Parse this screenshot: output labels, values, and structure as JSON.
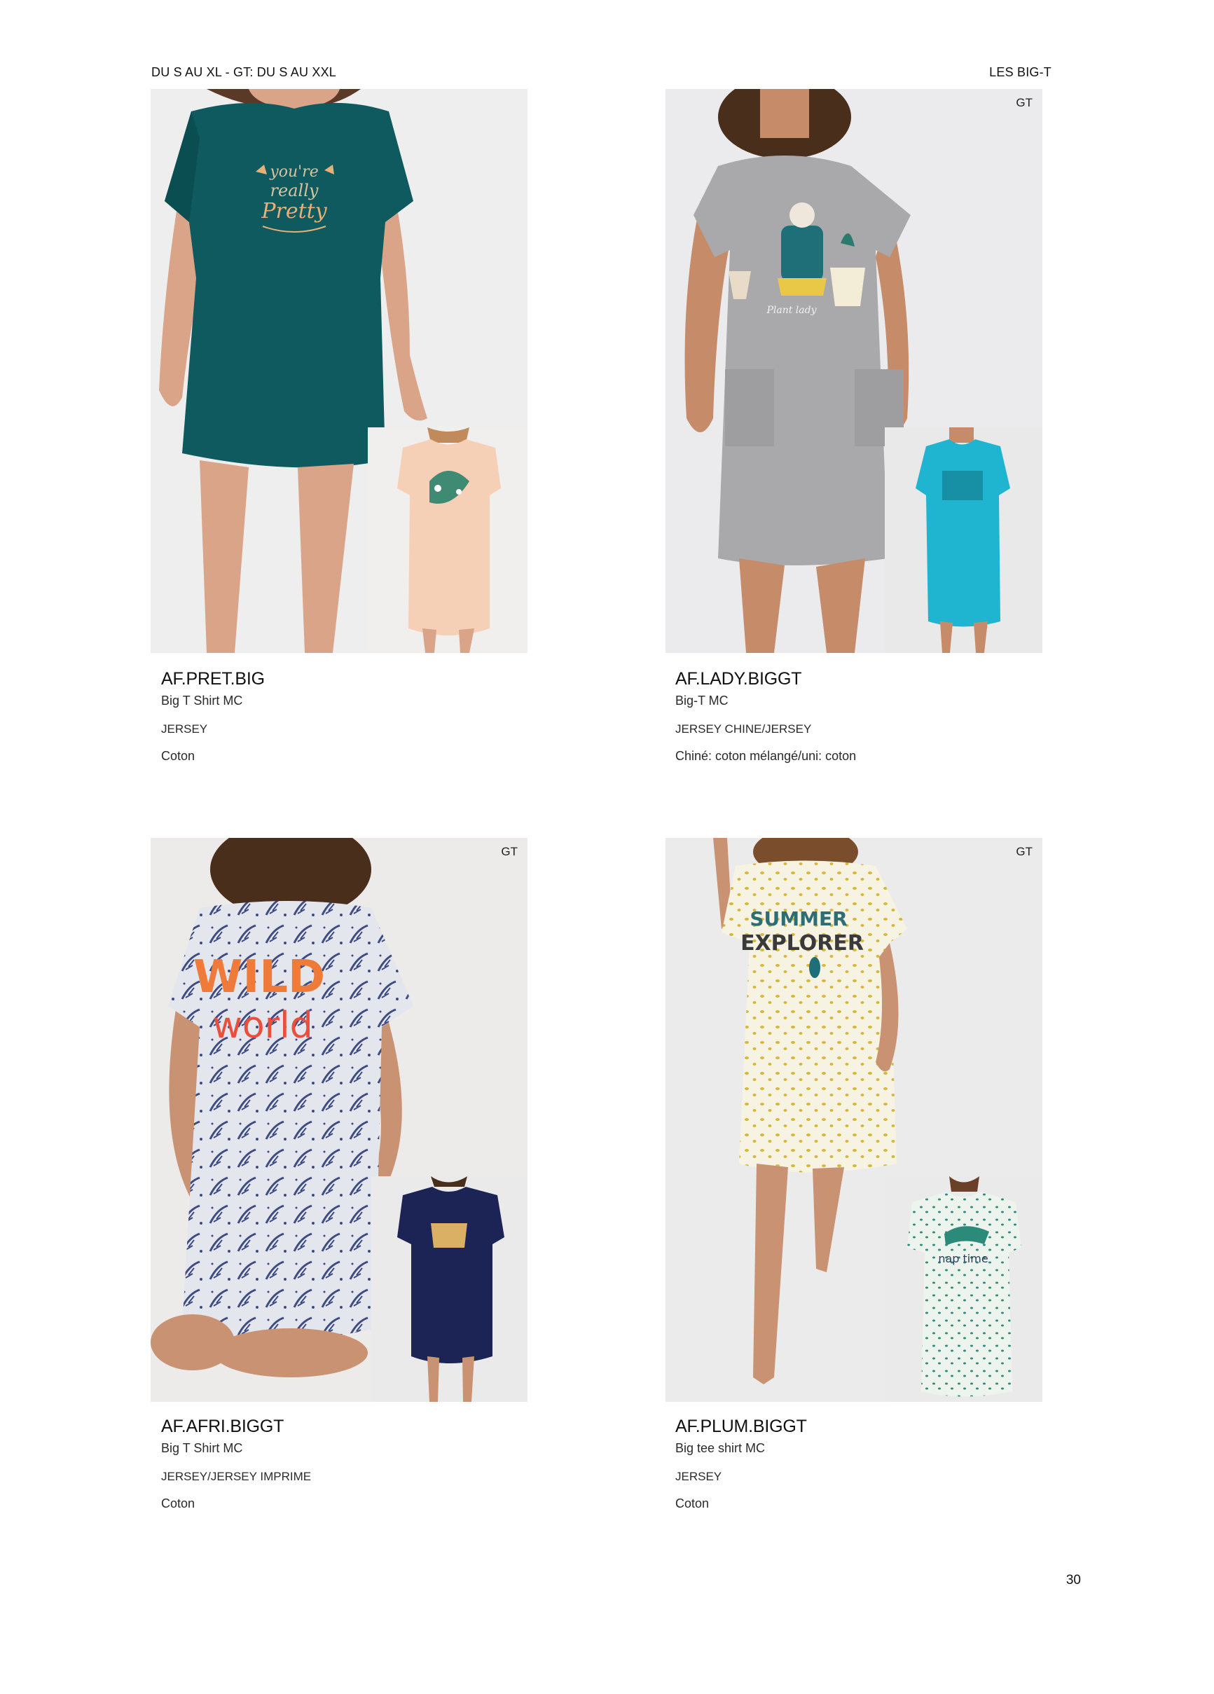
{
  "header": {
    "left": "DU S AU XL - GT: DU S AU XXL",
    "right": "LES BIG-T"
  },
  "page_number": "30",
  "products": [
    {
      "ref": "AF.PRET.BIG",
      "name": "Big T Shirt MC",
      "fabric": "JERSEY",
      "composition": "Coton",
      "badge": "",
      "print_text": "you're really Pretty",
      "main_color": "#0e5a5e",
      "inset_color": "#f6d0b6"
    },
    {
      "ref": "AF.LADY.BIGGT",
      "name": "Big-T MC",
      "fabric": "JERSEY CHINE/JERSEY",
      "composition": "Chiné: coton mélangé/uni: coton",
      "badge": "GT",
      "print_text": "Plant lady",
      "main_color": "#a9a9ab",
      "inset_color": "#1fb4cf"
    },
    {
      "ref": "AF.AFRI.BIGGT",
      "name": "Big T Shirt MC",
      "fabric": "JERSEY/JERSEY IMPRIME",
      "composition": "Coton",
      "badge": "GT",
      "print_text": "WILD world",
      "main_color": "#e4e6ee",
      "inset_color": "#1b2455"
    },
    {
      "ref": "AF.PLUM.BIGGT",
      "name": "Big tee shirt MC",
      "fabric": "JERSEY",
      "composition": "Coton",
      "badge": "GT",
      "print_text": "SUMMER EXPLORER",
      "main_color": "#f7f3e2",
      "inset_color": "#edf4ee"
    }
  ]
}
